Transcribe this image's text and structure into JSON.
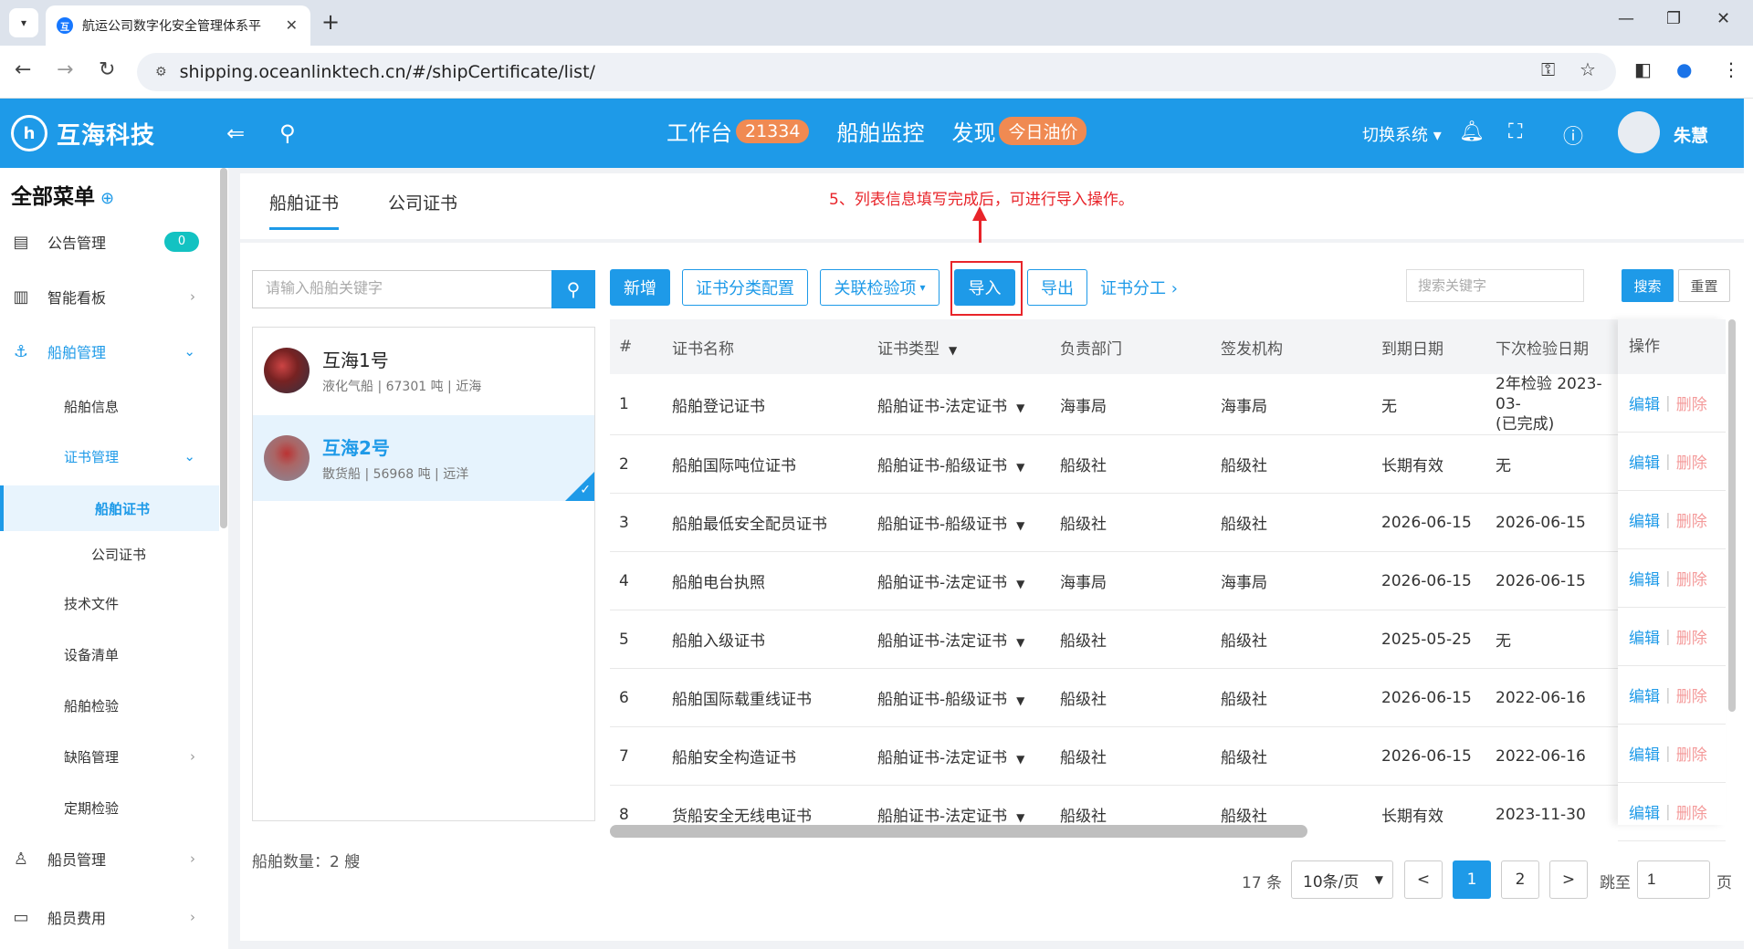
{
  "browser": {
    "tab_title": "航运公司数字化安全管理体系平",
    "url": "shipping.oceanlinktech.cn/#/shipCertificate/list/"
  },
  "header": {
    "logo_text": "互海科技",
    "nav": [
      {
        "label": "工作台",
        "badge": "21334"
      },
      {
        "label": "船舶监控",
        "badge": ""
      },
      {
        "label": "发现",
        "badge": "今日油价"
      }
    ],
    "switch_system": "切换系统",
    "user_name": "朱慧"
  },
  "sidebar": {
    "title": "全部菜单",
    "items": [
      {
        "label": "公告管理",
        "badge": "0"
      },
      {
        "label": "智能看板"
      },
      {
        "label": "船舶管理"
      },
      {
        "label": "船舶信息"
      },
      {
        "label": "证书管理"
      },
      {
        "label": "船舶证书"
      },
      {
        "label": "公司证书"
      },
      {
        "label": "技术文件"
      },
      {
        "label": "设备清单"
      },
      {
        "label": "船舶检验"
      },
      {
        "label": "缺陷管理"
      },
      {
        "label": "定期检验"
      },
      {
        "label": "船员管理"
      },
      {
        "label": "船员费用"
      }
    ]
  },
  "content_tabs": [
    "船舶证书",
    "公司证书"
  ],
  "annotation": "5、列表信息填写完成后，可进行导入操作。",
  "ship_panel": {
    "search_placeholder": "请输入船舶关键字",
    "ships": [
      {
        "name": "互海1号",
        "desc": "液化气船 | 67301 吨 | 近海"
      },
      {
        "name": "互海2号",
        "desc": "散货船 | 56968 吨 | 远洋"
      }
    ],
    "count_text": "船舶数量：2 艘"
  },
  "toolbar": {
    "add": "新增",
    "category_config": "证书分类配置",
    "linked_inspection": "关联检验项",
    "import": "导入",
    "export": "导出",
    "division_link": "证书分工",
    "search_placeholder": "搜索关键字",
    "search": "搜索",
    "reset": "重置"
  },
  "table": {
    "headers": [
      "#",
      "证书名称",
      "证书类型",
      "负责部门",
      "签发机构",
      "到期日期",
      "下次检验日期",
      "操作"
    ],
    "rows": [
      {
        "no": "1",
        "name": "船舶登记证书",
        "type": "船舶证书-法定证书",
        "dept": "海事局",
        "issuer": "海事局",
        "expiry": "无",
        "next": "2年检验 2023-03-",
        "next2": "(已完成)"
      },
      {
        "no": "2",
        "name": "船舶国际吨位证书",
        "type": "船舶证书-船级证书",
        "dept": "船级社",
        "issuer": "船级社",
        "expiry": "长期有效",
        "next": "无",
        "next2": ""
      },
      {
        "no": "3",
        "name": "船舶最低安全配员证书",
        "type": "船舶证书-船级证书",
        "dept": "船级社",
        "issuer": "船级社",
        "expiry": "2026-06-15",
        "next": "2026-06-15",
        "next2": ""
      },
      {
        "no": "4",
        "name": "船舶电台执照",
        "type": "船舶证书-法定证书",
        "dept": "海事局",
        "issuer": "海事局",
        "expiry": "2026-06-15",
        "next": "2026-06-15",
        "next2": ""
      },
      {
        "no": "5",
        "name": "船舶入级证书",
        "type": "船舶证书-法定证书",
        "dept": "船级社",
        "issuer": "船级社",
        "expiry": "2025-05-25",
        "next": "无",
        "next2": ""
      },
      {
        "no": "6",
        "name": "船舶国际载重线证书",
        "type": "船舶证书-船级证书",
        "dept": "船级社",
        "issuer": "船级社",
        "expiry": "2026-06-15",
        "next": "2022-06-16",
        "next2": ""
      },
      {
        "no": "7",
        "name": "船舶安全构造证书",
        "type": "船舶证书-法定证书",
        "dept": "船级社",
        "issuer": "船级社",
        "expiry": "2026-06-15",
        "next": "2022-06-16",
        "next2": ""
      },
      {
        "no": "8",
        "name": "货船安全无线电证书",
        "type": "船舶证书-法定证书",
        "dept": "船级社",
        "issuer": "船级社",
        "expiry": "长期有效",
        "next": "2023-11-30",
        "next2": ""
      }
    ],
    "edit": "编辑",
    "delete": "删除"
  },
  "pagination": {
    "total": "17 条",
    "page_size": "10条/页",
    "pages": [
      "1",
      "2"
    ],
    "prev": "<",
    "next": ">",
    "jump_label": "跳至",
    "jump_value": "1",
    "page_suffix": "页"
  },
  "colors": {
    "primary": "#1e9ae8",
    "annotation": "#e8242a",
    "badge": "#f08a52",
    "danger_text": "#f49a9a"
  }
}
